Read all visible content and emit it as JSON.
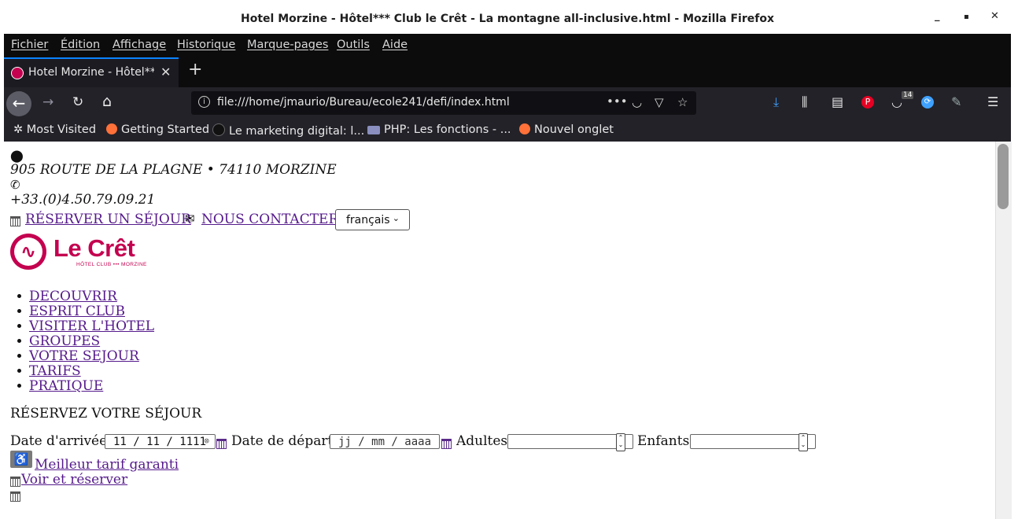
{
  "window": {
    "title": "Hotel Morzine - Hôtel*** Club le Crêt - La montagne all-inclusive.html - Mozilla Firefox",
    "controls": {
      "minimize": "_",
      "maximize": "▪",
      "close": "✕"
    }
  },
  "menubar": [
    "Fichier",
    "Édition",
    "Affichage",
    "Historique",
    "Marque-pages",
    "Outils",
    "Aide"
  ],
  "tab": {
    "title": "Hotel Morzine - Hôtel**",
    "close": "✕",
    "new_tab": "+"
  },
  "toolbar": {
    "back": "←",
    "forward": "→",
    "reload": "↻",
    "home": "⌂",
    "url": "file:///home/jmaurio/Bureau/ecole241/defi/index.html",
    "page_actions": "•••",
    "pocket_count": "14",
    "menu": "☰"
  },
  "bookmarks": [
    "Most Visited",
    "Getting Started",
    "Le marketing digital: l...",
    "PHP: Les fonctions - ...",
    "Nouvel onglet"
  ],
  "page": {
    "address": "905 ROUTE DE LA PLAGNE • 74110 MORZINE",
    "phone": "+33.(0)4.50.79.09.21",
    "reserve_link": "RÉSERVER UN SÉJOUR",
    "contact_link": "NOUS CONTACTER",
    "language": "français",
    "logo_text": "Le Crêt",
    "logo_sub": "HÔTEL CLUB ••• MORZINE",
    "nav": [
      "DECOUVRIR",
      "ESPRIT CLUB",
      "VISITER L'HOTEL",
      "GROUPES",
      "VOTRE SEJOUR",
      "TARIFS",
      "PRATIQUE"
    ],
    "booking_heading": "RÉSERVEZ VOTRE SÉJOUR",
    "arrival_label": "Date d'arrivée",
    "arrival_value": "11 / 11 / 1111",
    "departure_label": "Date de départ",
    "departure_placeholder": "jj / mm / aaaa",
    "adults_label": "Adultes",
    "children_label": "Enfants",
    "best_rate": "Meilleur tarif garanti",
    "see_book": "Voir et réserver"
  }
}
